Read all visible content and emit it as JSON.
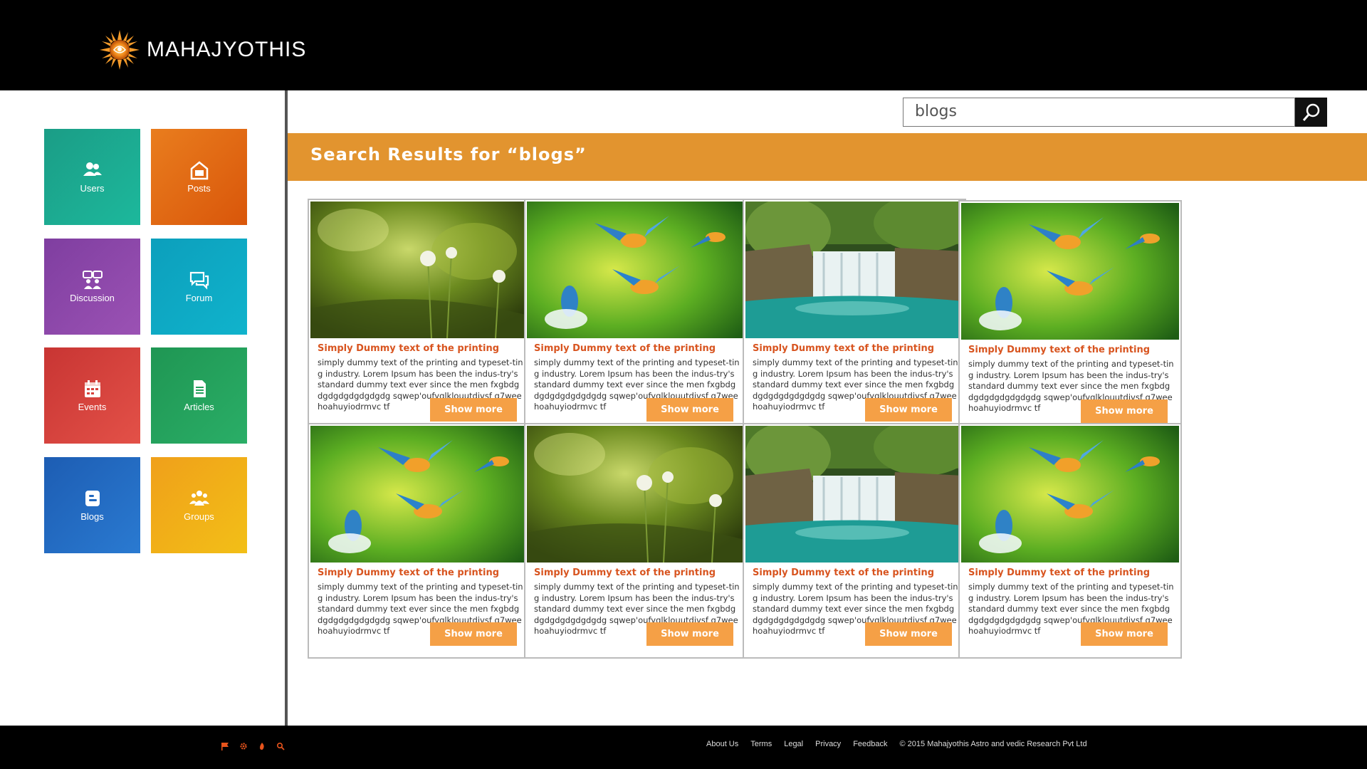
{
  "app": {
    "brand": "MAHAJYOTHIS"
  },
  "sidebar": {
    "tiles": [
      {
        "label": "Users",
        "icon": "users-icon",
        "color": "#1aa88e"
      },
      {
        "label": "Posts",
        "icon": "posts-icon",
        "color": "#e2620c"
      },
      {
        "label": "Discussion",
        "icon": "discussion-icon",
        "color": "#8f47a8"
      },
      {
        "label": "Forum",
        "icon": "forum-icon",
        "color": "#0eabc4"
      },
      {
        "label": "Events",
        "icon": "calendar-icon",
        "color": "#d73d3a"
      },
      {
        "label": "Articles",
        "icon": "article-icon",
        "color": "#24a05b"
      },
      {
        "label": "Blogs",
        "icon": "blogger-icon",
        "color": "#2168bf"
      },
      {
        "label": "Groups",
        "icon": "groups-icon",
        "color": "#f1a21a"
      }
    ]
  },
  "search": {
    "value": "blogs"
  },
  "results": {
    "title": "Search Results for “blogs”",
    "cards": [
      {
        "image": "dandelion",
        "title": "Simply Dummy text of the printing",
        "desc": "simply dummy text of the printing and typeset-ting industry. Lorem Ipsum has been the indus-try's standard dummy text ever since the men fxgbdgdgdgdgdgdgdgdg sqwep'oufyglklouutdjvsf q7weehoahuyiodrmvc tf",
        "button": "Show more"
      },
      {
        "image": "kingfishers",
        "title": "Simply Dummy text of the printing",
        "desc": "simply dummy text of the printing and typeset-ting industry. Lorem Ipsum has been the indus-try's standard dummy text ever since the men fxgbdgdgdgdgdgdgdgdg sqwep'oufyglklouutdjvsf q7weehoahuyiodrmvc tf",
        "button": "Show more"
      },
      {
        "image": "waterfall",
        "title": "Simply Dummy text of the printing",
        "desc": "simply dummy text of the printing and typeset-ting industry. Lorem Ipsum has been the indus-try's standard dummy text ever since the men fxgbdgdgdgdgdgdgdgdg sqwep'oufyglklouutdjvsf q7weehoahuyiodrmvc tf",
        "button": "Show more"
      },
      {
        "image": "kingfishers",
        "title": "Simply Dummy text of the printing",
        "desc": "simply dummy text of the printing and typeset-ting industry. Lorem Ipsum has been the indus-try's standard dummy text ever since the men fxgbdgdgdgdgdgdgdgdg sqwep'oufyglklouutdjvsf q7weehoahuyiodrmvc tf",
        "button": "Show more"
      },
      {
        "image": "kingfishers",
        "title": "Simply Dummy text of the printing",
        "desc": "simply dummy text of the printing and typeset-ting industry. Lorem Ipsum has been the indus-try's standard dummy text ever since the men fxgbdgdgdgdgdgdgdgdg sqwep'oufyglklouutdjvsf q7weehoahuyiodrmvc tf",
        "button": "Show more"
      },
      {
        "image": "dandelion",
        "title": "Simply Dummy text of the printing",
        "desc": "simply dummy text of the printing and typeset-ting industry. Lorem Ipsum has been the indus-try's standard dummy text ever since the men fxgbdgdgdgdgdgdgdgdg sqwep'oufyglklouutdjvsf q7weehoahuyiodrmvc tf",
        "button": "Show more"
      },
      {
        "image": "waterfall",
        "title": "Simply Dummy text of the printing",
        "desc": "simply dummy text of the printing and typeset-ting industry. Lorem Ipsum has been the indus-try's standard dummy text ever since the men fxgbdgdgdgdgdgdgdgdg sqwep'oufyglklouutdjvsf q7weehoahuyiodrmvc tf",
        "button": "Show more"
      },
      {
        "image": "kingfishers",
        "title": "Simply Dummy text of the printing",
        "desc": "simply dummy text of the printing and typeset-ting industry. Lorem Ipsum has been the indus-try's standard dummy text ever since the men fxgbdgdgdgdgdgdgdgdg sqwep'oufyglklouutdjvsf q7weehoahuyiodrmvc tf",
        "button": "Show more"
      }
    ]
  },
  "footer": {
    "icons": [
      "flag-icon",
      "gear-icon",
      "fire-icon",
      "search-icon"
    ],
    "links": [
      "About Us",
      "Terms",
      "Legal",
      "Privacy",
      "Feedback"
    ],
    "copyright": "© 2015 Mahajyothis Astro and vedic Research Pvt Ltd"
  },
  "colors": {
    "accent": "#e2942f",
    "card_title": "#d8541f",
    "button": "#f5a046"
  }
}
